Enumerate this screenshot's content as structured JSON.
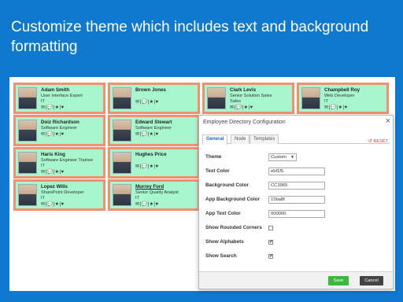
{
  "headline": "Customize theme which includes text and background formatting",
  "action_icons": "✉|💬|★|♥",
  "employees": [
    {
      "name": "Adam Smith",
      "title": "User Interface Expert",
      "dept": "IT"
    },
    {
      "name": "Brown Jones",
      "title": "",
      "dept": ""
    },
    {
      "name": "Clark Levis",
      "title": "Senior Solution Sales",
      "dept": "Sales"
    },
    {
      "name": "Champbell Roy",
      "title": "Web Developer",
      "dept": "IT"
    },
    {
      "name": "Doiz Richardson",
      "title": "Software Engineer",
      "dept": ""
    },
    {
      "name": "Edward Stewart",
      "title": "Software Engineer",
      "dept": ""
    },
    {
      "name": "Haris King",
      "title": "Software Engineer Trainee",
      "dept": "IT"
    },
    {
      "name": "Hughes Price",
      "title": "",
      "dept": ""
    },
    {
      "name": "Lopez Wills",
      "title": "SharePoint Developer",
      "dept": "IT"
    },
    {
      "name": "Murrey Ford",
      "title": "Senior Quality Analyst",
      "dept": "IT"
    }
  ],
  "dialog": {
    "title": "Employee Directory Configuration",
    "close": "×",
    "tabs": [
      "General",
      "Node",
      "Templates"
    ],
    "reset": "RESET",
    "reset_icon": "↺",
    "fields": {
      "theme_label": "Theme",
      "theme_value": "Custom",
      "text_color_label": "Text Color",
      "text_color_value": "ebf1f5",
      "bg_color_label": "Background Color",
      "bg_color_value": "CC3965",
      "app_bg_color_label": "App Background Color",
      "app_bg_color_value": "15ba8f",
      "app_text_color_label": "App Text Color",
      "app_text_color_value": "000000",
      "rounded_label": "Show Rounded Corners",
      "rounded_checked": "",
      "alphabets_label": "Show Alphabets",
      "alphabets_checked": "✔",
      "search_label": "Show Search",
      "search_checked": "✔"
    },
    "save": "Save",
    "cancel": "Cancel"
  },
  "colors": {
    "page_bg": "#0f79d0",
    "card_bg": "#a7f6ce",
    "card_border": "#f0906e",
    "save_button": "#3bb83d",
    "reset_text": "#d93b36"
  }
}
